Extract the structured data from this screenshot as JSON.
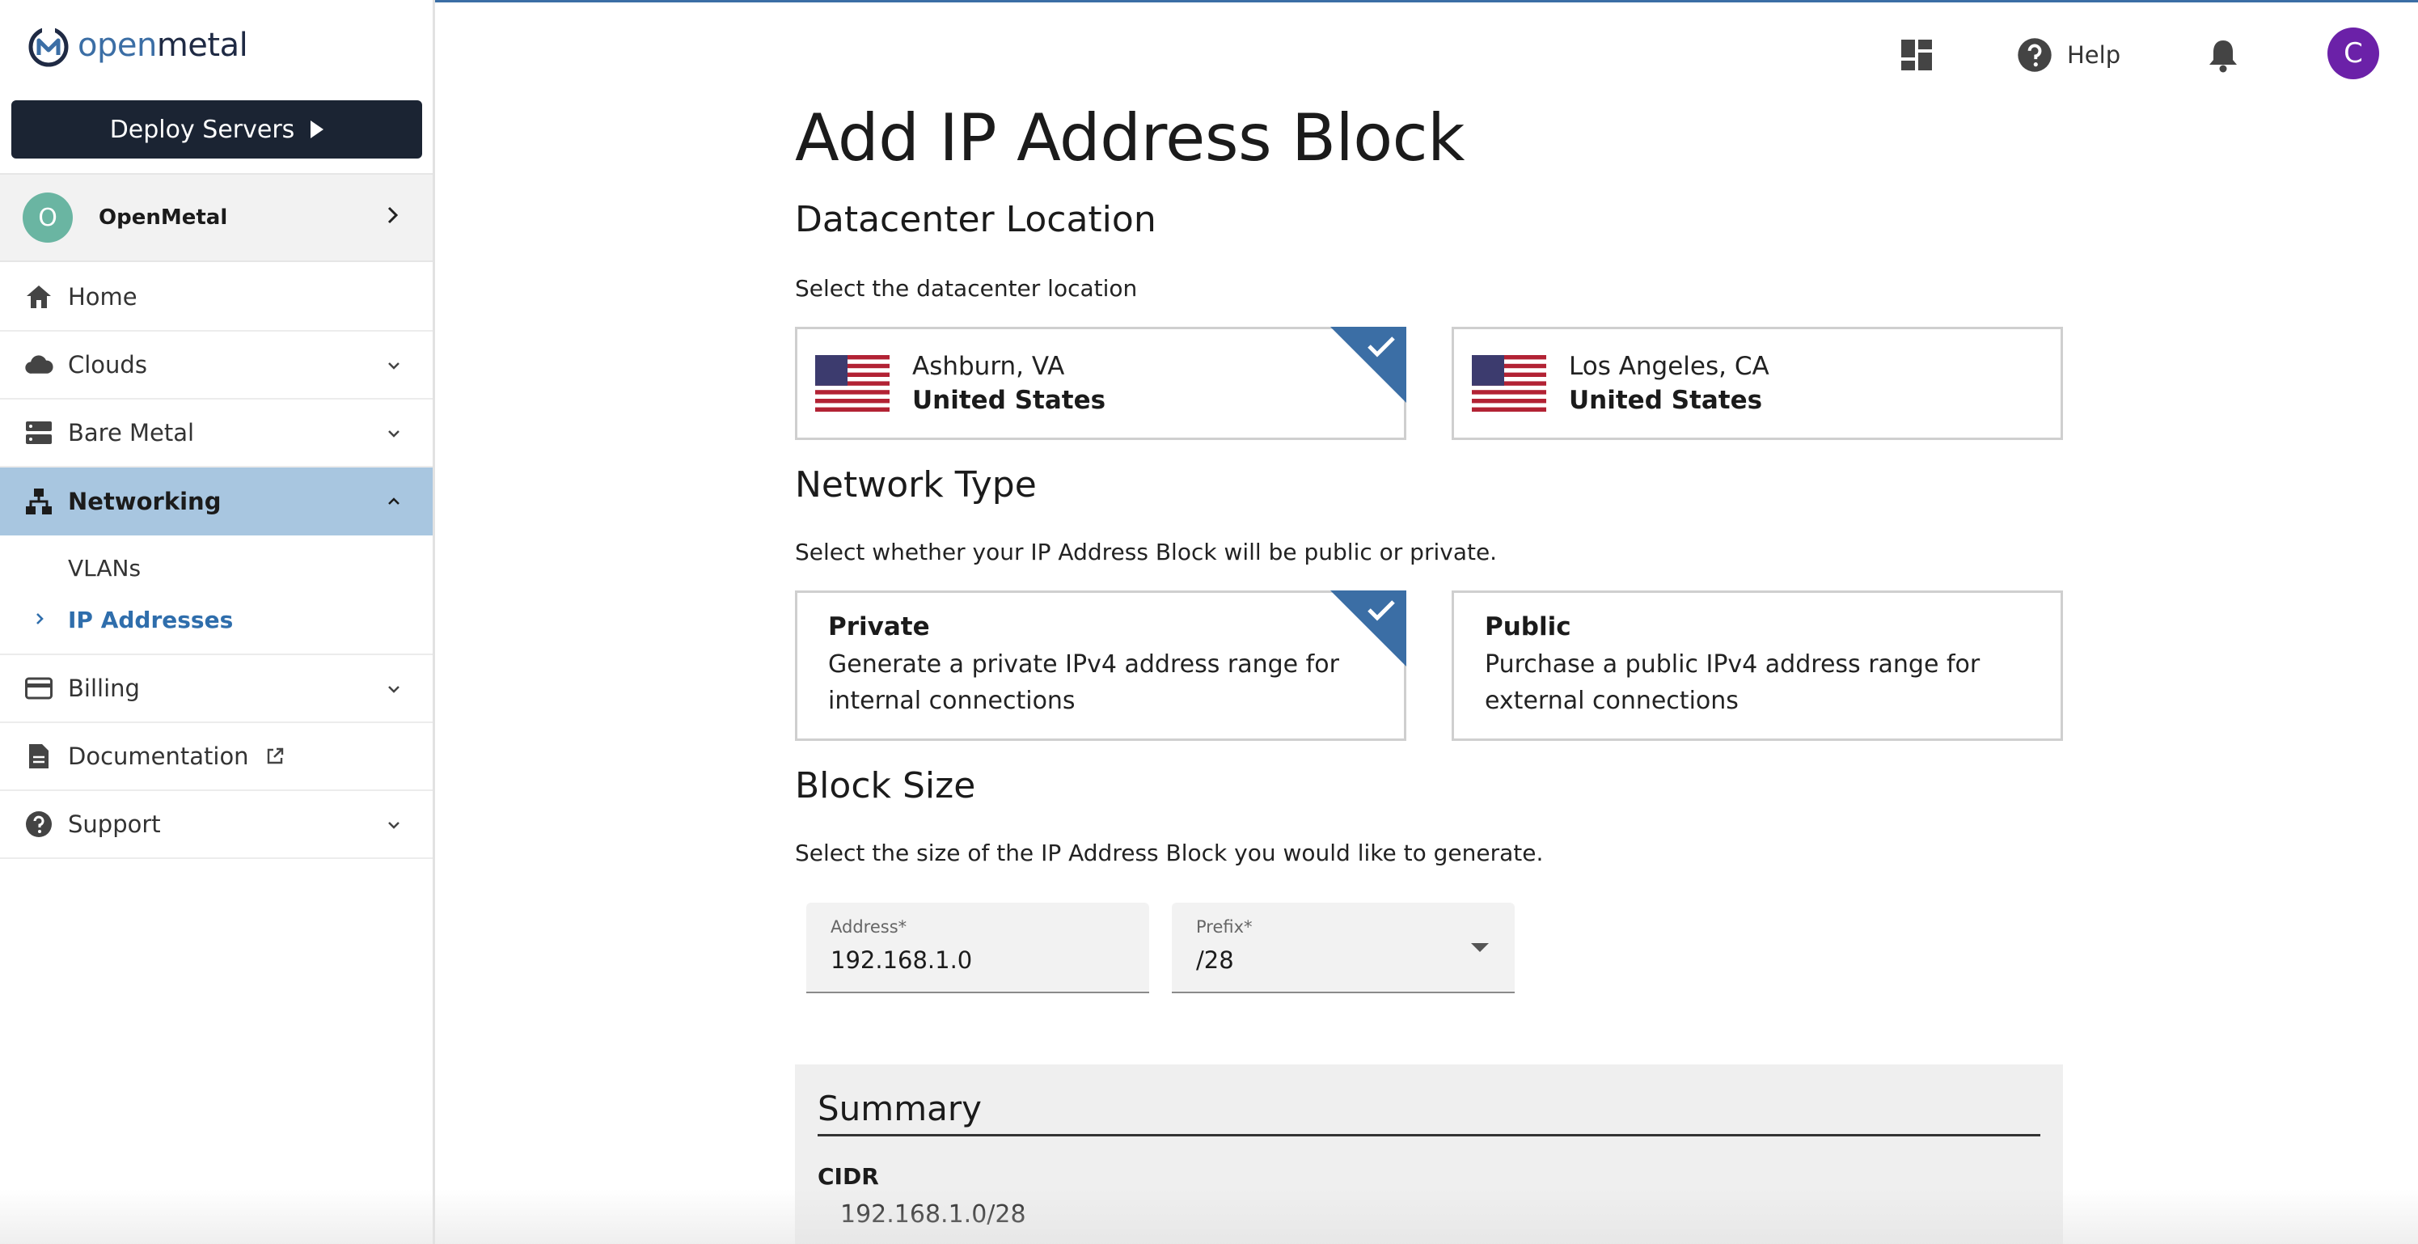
{
  "brand": {
    "logo_prefix": "open",
    "logo_suffix": "metal",
    "accent_color": "#3b6ea5",
    "sidebar_active_color": "#a8c6e0",
    "avatar_color": "#6b21a8"
  },
  "sidebar": {
    "deploy_label": "Deploy Servers",
    "org": {
      "initial": "O",
      "name": "OpenMetal"
    },
    "nav": {
      "home": {
        "label": "Home",
        "icon": "home-icon"
      },
      "clouds": {
        "label": "Clouds",
        "icon": "cloud-icon"
      },
      "bare_metal": {
        "label": "Bare Metal",
        "icon": "server-icon"
      },
      "networking": {
        "label": "Networking",
        "icon": "network-icon"
      },
      "billing": {
        "label": "Billing",
        "icon": "credit-card-icon"
      },
      "documentation": {
        "label": "Documentation",
        "icon": "document-icon"
      },
      "support": {
        "label": "Support",
        "icon": "help-circle-icon"
      }
    },
    "networking_sub": {
      "vlans": "VLANs",
      "ip_addresses": "IP Addresses"
    }
  },
  "header": {
    "help_label": "Help",
    "user_initial": "C"
  },
  "main": {
    "title": "Add IP Address Block",
    "datacenter": {
      "title": "Datacenter Location",
      "description": "Select the datacenter location",
      "options": [
        {
          "city": "Ashburn, VA",
          "country": "United States",
          "selected": true
        },
        {
          "city": "Los Angeles, CA",
          "country": "United States",
          "selected": false
        }
      ]
    },
    "network_type": {
      "title": "Network Type",
      "description": "Select whether your IP Address Block will be public or private.",
      "options": [
        {
          "title": "Private",
          "description": "Generate a private IPv4 address range for internal connections",
          "selected": true
        },
        {
          "title": "Public",
          "description": "Purchase a public IPv4 address range for external connections",
          "selected": false
        }
      ]
    },
    "block_size": {
      "title": "Block Size",
      "description": "Select the size of the IP Address Block you would like to generate.",
      "address_label": "Address*",
      "address_value": "192.168.1.0",
      "prefix_label": "Prefix*",
      "prefix_value": "/28"
    },
    "summary": {
      "title": "Summary",
      "cidr_label": "CIDR",
      "cidr_value": "192.168.1.0/28"
    }
  }
}
